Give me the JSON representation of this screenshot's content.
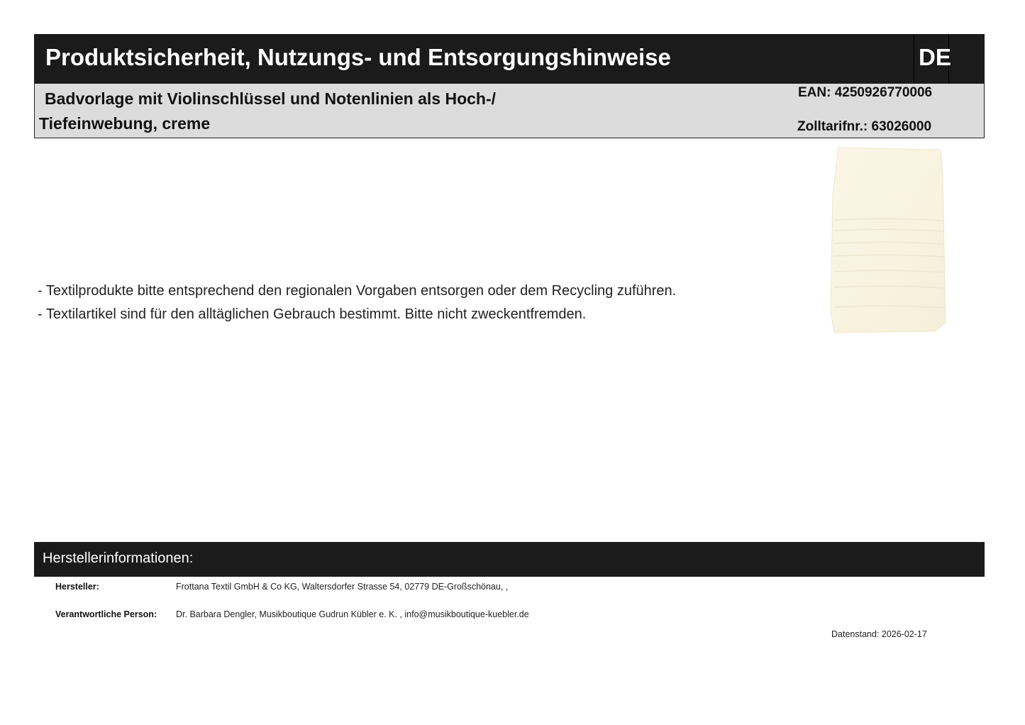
{
  "header": {
    "title": "Produktsicherheit, Nutzungs- und Entsorgungshinweise",
    "language": "DE"
  },
  "product": {
    "name_line1": "Badvorlage mit Violinschlüssel und Notenlinien als Hoch-/",
    "name_line2": "Tiefeinwebung, creme",
    "ean": "EAN: 4250926770006",
    "tariff": "Zolltarifnr.: 63026000",
    "image_color": "#fbf6e6"
  },
  "notes": [
    "- Textilprodukte bitte entsprechend den regionalen Vorgaben entsorgen oder dem Recycling zuführen.",
    "- Textilartikel sind für den alltäglichen Gebrauch bestimmt. Bitte nicht zweckentfremden."
  ],
  "manufacturer_section": {
    "title": "Herstellerinformationen:",
    "manufacturer_label": "Hersteller:",
    "manufacturer_value": "Frottana Textil GmbH & Co KG, Waltersdorfer Strasse 54, 02779 DE-Großschönau, ,",
    "responsible_label": "Verantwortliche Person:",
    "responsible_value": "Dr. Barbara Dengler, Musikboutique Gudrun Kübler e. K. , info@musikboutique-kuebler.de"
  },
  "date": "Datenstand: 2026-02-17"
}
